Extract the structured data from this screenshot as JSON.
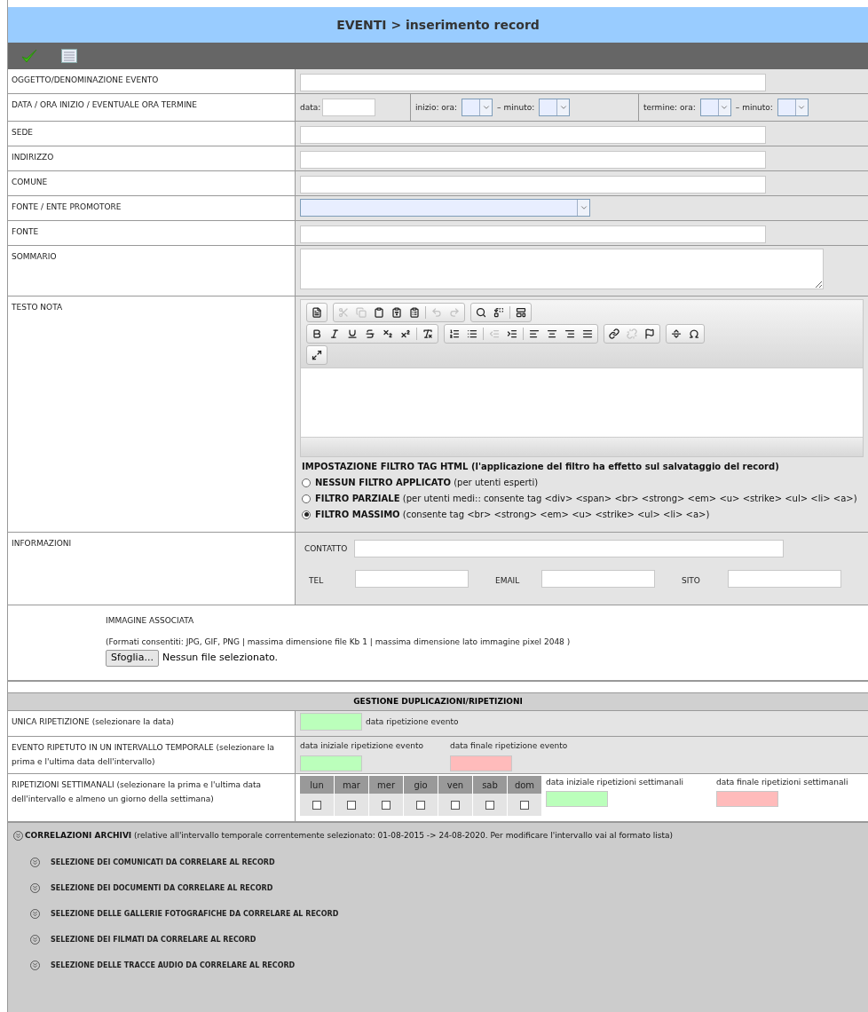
{
  "title": "EVENTI > inserimento record",
  "rows": [
    {
      "kind": "text",
      "label": "OGGETTO/DENOMINAZIONE EVENTO"
    },
    {
      "kind": "datetime",
      "label": "DATA / ORA INIZIO / EVENTUALE ORA TERMINE",
      "date_label": "data:",
      "start": {
        "hour_label": "inizio: ora:",
        "minute_label": "– minuto:"
      },
      "end": {
        "hour_label": "termine: ora:",
        "minute_label": "– minuto:"
      }
    },
    {
      "kind": "text",
      "label": "SEDE"
    },
    {
      "kind": "text",
      "label": "INDIRIZZO"
    },
    {
      "kind": "text",
      "label": "COMUNE"
    },
    {
      "kind": "select",
      "label": "FONTE / ENTE PROMOTORE"
    },
    {
      "kind": "text",
      "label": "FONTE"
    },
    {
      "kind": "textarea",
      "label": "SOMMARIO"
    },
    {
      "kind": "editor",
      "label": "TESTO NOTA"
    },
    {
      "kind": "contacts",
      "label": "INFORMAZIONI",
      "contact_label": "CONTATTO",
      "fields": [
        "TEL",
        "EMAIL",
        "SITO"
      ]
    }
  ],
  "editor": {
    "toolbar_rows": [
      [
        [
          {
            "kind": "new",
            "disabled": false
          }
        ],
        [
          {
            "kind": "cut",
            "disabled": true
          },
          {
            "kind": "copy",
            "disabled": true
          },
          {
            "kind": "paste",
            "disabled": false
          },
          {
            "kind": "paste-text",
            "disabled": false
          },
          {
            "kind": "paste-word",
            "disabled": false
          },
          {
            "kind": "sep"
          },
          {
            "kind": "undo",
            "disabled": true
          },
          {
            "kind": "redo",
            "disabled": true
          }
        ],
        [
          {
            "kind": "find",
            "disabled": false
          },
          {
            "kind": "replace",
            "disabled": false
          },
          {
            "kind": "sep"
          },
          {
            "kind": "template",
            "disabled": false
          }
        ]
      ],
      [
        [
          {
            "kind": "bold",
            "disabled": false
          },
          {
            "kind": "italic",
            "disabled": false
          },
          {
            "kind": "underline",
            "disabled": false
          },
          {
            "kind": "strike",
            "disabled": false
          },
          {
            "kind": "subscript",
            "disabled": false
          },
          {
            "kind": "superscript",
            "disabled": false
          },
          {
            "kind": "sep"
          },
          {
            "kind": "clear-format",
            "disabled": false
          }
        ],
        [
          {
            "kind": "ordered-list",
            "disabled": false
          },
          {
            "kind": "bullet-list",
            "disabled": false
          },
          {
            "kind": "sep"
          },
          {
            "kind": "outdent",
            "disabled": true
          },
          {
            "kind": "indent",
            "disabled": false
          },
          {
            "kind": "sep"
          },
          {
            "kind": "align-left",
            "disabled": false
          },
          {
            "kind": "align-center",
            "disabled": false
          },
          {
            "kind": "align-right",
            "disabled": false
          },
          {
            "kind": "justify",
            "disabled": false
          }
        ],
        [
          {
            "kind": "link",
            "disabled": false
          },
          {
            "kind": "unlink",
            "disabled": true
          },
          {
            "kind": "anchor",
            "disabled": false
          }
        ],
        [
          {
            "kind": "rule",
            "disabled": false
          },
          {
            "kind": "special-char",
            "disabled": false
          }
        ]
      ],
      [
        [
          {
            "kind": "maximize",
            "disabled": false
          }
        ]
      ]
    ],
    "filter_title": "IMPOSTAZIONE FILTRO TAG HTML (l'applicazione del filtro ha effetto sul salvataggio del record)",
    "filters": [
      {
        "text": "**NESSUN FILTRO APPLICATO** (per utenti esperti)",
        "selected": false
      },
      {
        "text": "**FILTRO PARZIALE** (per utenti medi:: consente tag <div> <span> <br> <strong> <em> <u> <strike> <ul> <li> <a>)",
        "selected": false
      },
      {
        "text": "**FILTRO MASSIMO** (consente tag <br> <strong> <em> <u> <strike> <ul> <li> <a>)",
        "selected": true
      }
    ]
  },
  "image": {
    "title": "IMMAGINE ASSOCIATA",
    "formats": "(Formati consentiti: JPG, GIF, PNG | massima dimensione file Kb 1 | massima dimensione lato immagine pixel 2048 )",
    "button": "Sfoglia...",
    "status": "Nessun file selezionato."
  },
  "repetitions": {
    "title": "GESTIONE DUPLICAZIONI/RIPETIZIONI",
    "single": {
      "label": "UNICA RIPETIZIONE (selezionare la data)",
      "field_label": "data ripetizione evento",
      "color": "#bbffbb"
    },
    "interval": {
      "label": "EVENTO RIPETUTO IN UN INTERVALLO TEMPORALE (selezionare la prima e l'ultima data dell'intervallo)",
      "fields": [
        {
          "label": "data iniziale ripetizione evento",
          "color": "#bbffbb"
        },
        {
          "label": "data finale ripetizione evento",
          "color": "#ffbbbb"
        }
      ]
    },
    "weekly": {
      "label": "RIPETIZIONI SETTIMANALI (selezionare la prima e l'ultima data dell'intervallo e almeno un giorno della settimana)",
      "days": [
        {
          "label": "lun",
          "checked": false
        },
        {
          "label": "mar",
          "checked": false
        },
        {
          "label": "mer",
          "checked": false
        },
        {
          "label": "gio",
          "checked": false
        },
        {
          "label": "ven",
          "checked": false
        },
        {
          "label": "sab",
          "checked": false
        },
        {
          "label": "dom",
          "checked": false
        }
      ],
      "fields": [
        {
          "label": "data iniziale ripetizioni settimanali",
          "color": "#bbffbb"
        },
        {
          "label": "data finale ripetizioni settimanali",
          "color": "#ffbbbb"
        }
      ]
    }
  },
  "correlations": {
    "header": "**CORRELAZIONI ARCHIVI** (relative all'intervallo temporale correntemente selezionato: 01-08-2015 -> 24-08-2020. Per modificare l'intervallo vai al formato lista)",
    "items": [
      "SELEZIONE DEI COMUNICATI DA CORRELARE AL RECORD",
      "SELEZIONE DEI DOCUMENTI DA CORRELARE AL RECORD",
      "SELEZIONE DELLE GALLERIE FOTOGRAFICHE DA CORRELARE AL RECORD",
      "SELEZIONE DEI FILMATI DA CORRELARE AL RECORD",
      "SELEZIONE DELLE TRACCE AUDIO DA CORRELARE AL RECORD"
    ]
  }
}
